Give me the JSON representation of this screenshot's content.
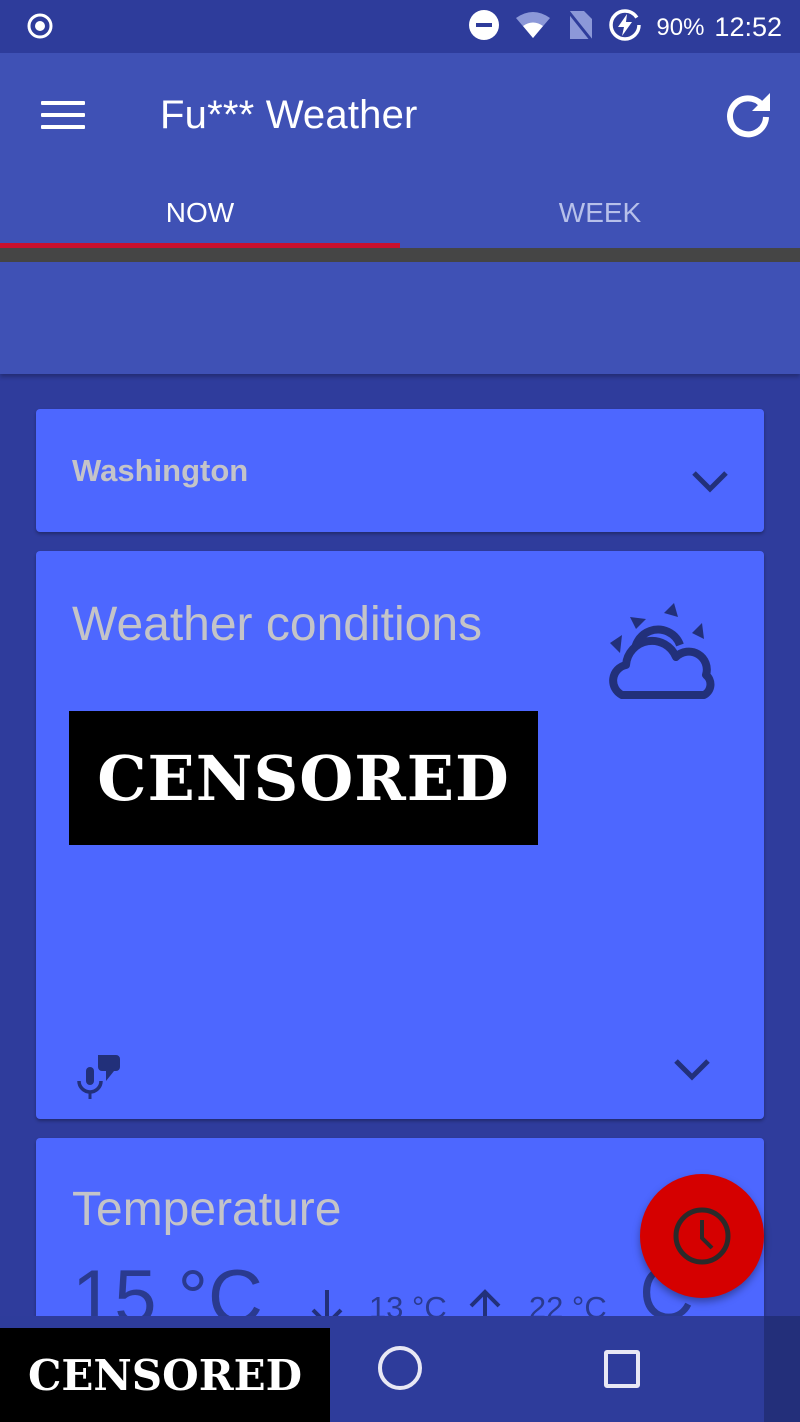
{
  "status_bar": {
    "battery": "90%",
    "time": "12:52",
    "icons": [
      "record-icon",
      "do-not-disturb-icon",
      "wifi-icon",
      "no-sim-icon",
      "battery-charging-icon"
    ]
  },
  "app_bar": {
    "title": "Fu*** Weather",
    "menu_icon": "hamburger-menu-icon",
    "refresh_icon": "refresh-icon"
  },
  "tabs": [
    {
      "label": "NOW",
      "active": true
    },
    {
      "label": "WEEK",
      "active": false
    }
  ],
  "colors": {
    "primary": "#3f51b5",
    "card": "#4d67ff",
    "accent": "#d50000",
    "tab_indicator": "#c8102e"
  },
  "location_card": {
    "location": "Washington",
    "expand_icon": "chevron-down-icon"
  },
  "conditions_card": {
    "title": "Weather conditions",
    "redacted_label": "CENSORED",
    "weather_icon": "partly-cloudy-icon",
    "voice_icon": "voice-chat-icon",
    "expand_icon": "chevron-down-icon"
  },
  "temperature_card": {
    "title": "Temperature",
    "current": "15 °C",
    "min": "13 °C",
    "max": "22 °C",
    "partial_glyph": "C"
  },
  "fab": {
    "icon": "clock-icon"
  },
  "nav_bar": {
    "redacted_label": "CENSORED",
    "home_icon": "home-icon",
    "recents_icon": "recents-icon"
  }
}
